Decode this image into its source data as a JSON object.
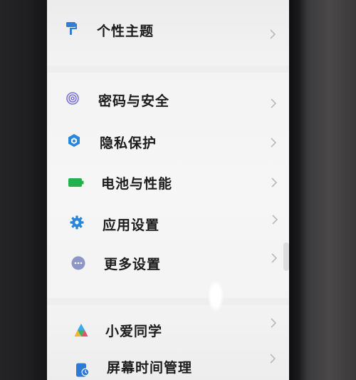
{
  "settings_list": {
    "items": [
      {
        "label": "个性主题",
        "icon": "paint-roller-icon",
        "color": "#2f7fd6"
      },
      {
        "label": "密码与安全",
        "icon": "fingerprint-icon",
        "color": "#7b74d8"
      },
      {
        "label": "隐私保护",
        "icon": "privacy-cube-icon",
        "color": "#2a86d8"
      },
      {
        "label": "电池与性能",
        "icon": "battery-icon",
        "color": "#22b14c"
      },
      {
        "label": "应用设置",
        "icon": "gear-icon",
        "color": "#2a86d8"
      },
      {
        "label": "更多设置",
        "icon": "more-dots-icon",
        "color": "#8d96c6"
      },
      {
        "label": "小爱同学",
        "icon": "xiaoai-icon",
        "color": "#e84d6d"
      },
      {
        "label": "屏幕时间管理",
        "icon": "screen-time-icon",
        "color": "#2a7ad6"
      }
    ],
    "chevron_icon": "chevron-right-icon"
  }
}
